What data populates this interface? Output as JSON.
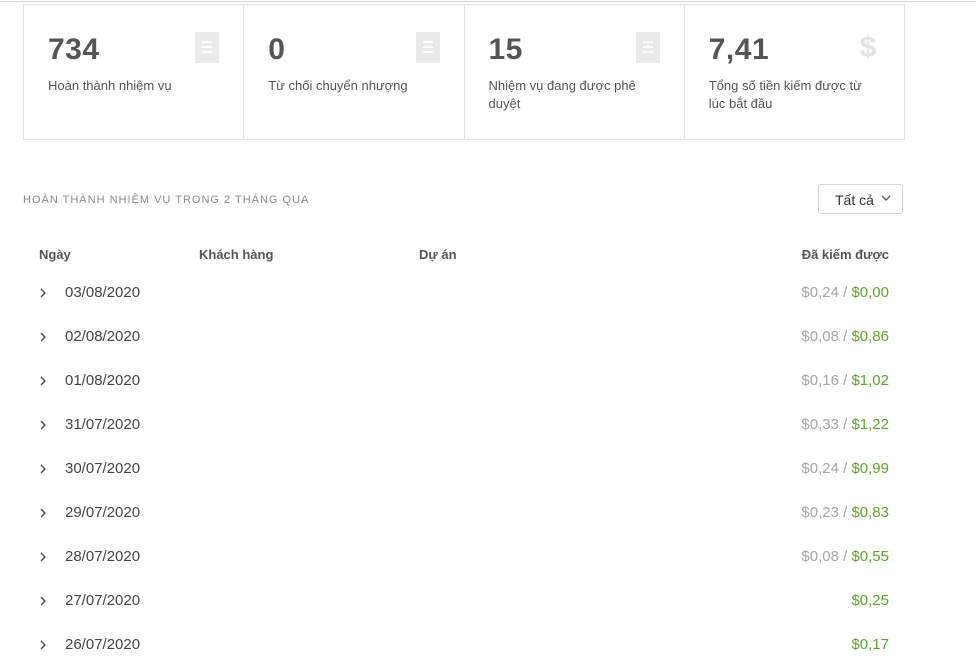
{
  "stats": [
    {
      "value": "734",
      "label": "Hoàn thành nhiệm vụ",
      "icon": "document-icon"
    },
    {
      "value": "0",
      "label": "Từ chối chuyển nhượng",
      "icon": "document-icon"
    },
    {
      "value": "15",
      "label": "Nhiệm vụ đang được phê duyệt",
      "icon": "document-icon"
    },
    {
      "value": "7,41",
      "label": "Tổng số tiền kiếm được từ lúc bắt đầu",
      "icon": "dollar-icon",
      "icon_glyph": "$"
    }
  ],
  "section": {
    "title": "HOÀN THÀNH NHIỆM VỤ TRONG 2 THÁNG QUA",
    "filter_label": "Tất cả"
  },
  "table": {
    "headers": {
      "date": "Ngày",
      "client": "Khách hàng",
      "project": "Dự án",
      "earned": "Đã kiếm được"
    },
    "rows": [
      {
        "date": "03/08/2020",
        "pending": "$0,24",
        "separator": " / ",
        "paid": "$0,00"
      },
      {
        "date": "02/08/2020",
        "pending": "$0,08",
        "separator": " / ",
        "paid": "$0,86"
      },
      {
        "date": "01/08/2020",
        "pending": "$0,16",
        "separator": " / ",
        "paid": "$1,02"
      },
      {
        "date": "31/07/2020",
        "pending": "$0,33",
        "separator": " / ",
        "paid": "$1,22"
      },
      {
        "date": "30/07/2020",
        "pending": "$0,24",
        "separator": " / ",
        "paid": "$0,99"
      },
      {
        "date": "29/07/2020",
        "pending": "$0,23",
        "separator": " / ",
        "paid": "$0,83"
      },
      {
        "date": "28/07/2020",
        "pending": "$0,08",
        "separator": " / ",
        "paid": "$0,55"
      },
      {
        "date": "27/07/2020",
        "pending": "",
        "separator": "",
        "paid": "$0,25"
      },
      {
        "date": "26/07/2020",
        "pending": "",
        "separator": "",
        "paid": "$0,17"
      }
    ]
  },
  "colors": {
    "paid": "#5fa62f",
    "pending": "#a6a6a6",
    "text": "#555555",
    "border": "#e2e2e2"
  }
}
